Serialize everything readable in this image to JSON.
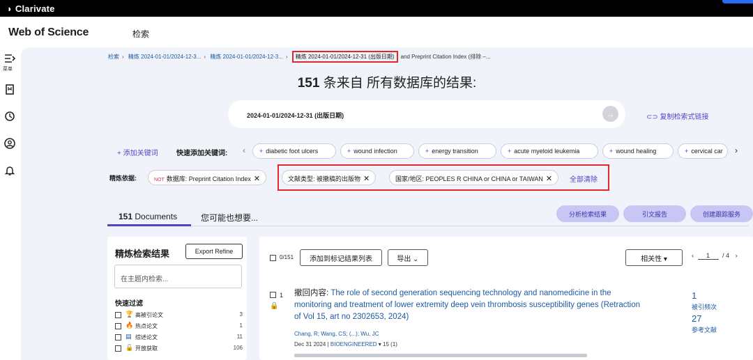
{
  "topbar": {
    "brand": "Clarivate"
  },
  "header": {
    "logo": "Web of Science",
    "nav_search": "检索"
  },
  "rail": {
    "menu_label": "菜单"
  },
  "breadcrumb": {
    "items": [
      "检索",
      "精炼 2024-01-01/2024-12-3...",
      "精炼 2024-01-01/2024-12-3..."
    ],
    "active": "精炼 2024-01-01/2024-12-31 (出版日期)",
    "tail": "and Preprint Citation Index (排除 –..."
  },
  "results": {
    "count": "151",
    "title_rest": "条来自 所有数据库的结果:"
  },
  "query": {
    "text": "2024-01-01/2024-12-31 (出版日期)",
    "go_glyph": "→"
  },
  "copy_link": "复制检索式链接",
  "keywords": {
    "add_label": "+ 添加关键词",
    "quick_label": "快速添加关键词:",
    "chips": [
      "diabetic foot ulcers",
      "wound infection",
      "energy transition",
      "acute myeloid leukemia",
      "wound healing",
      "cervical car"
    ]
  },
  "refine": {
    "label": "精炼依据:",
    "not_tag": "NOT",
    "chip1": "数据库: Preprint Citation Index",
    "chip2": "文献类型: 被撤稿的出版物",
    "chip3": "国家/地区: PEOPLES R CHINA or CHINA or TAIWAN",
    "clear_all": "全部清除"
  },
  "tabs": {
    "docs_count": "151",
    "docs_label": "Documents",
    "maybe": "您可能也想要..."
  },
  "actions": {
    "analyze": "分析检索结果",
    "citation_report": "引文报告",
    "create_alert": "创建跟踪服务"
  },
  "left_panel": {
    "title": "精炼检索结果",
    "export": "Export Refine",
    "search_placeholder": "在主题内检索...",
    "quick_filter": "快速过滤",
    "filters": [
      {
        "icon": "trophy-icon",
        "glyph": "🏆",
        "label": "高被引论文",
        "count": "3"
      },
      {
        "icon": "flame-icon",
        "glyph": "🔥",
        "label": "热点论文",
        "count": "1"
      },
      {
        "icon": "review-doc-icon",
        "glyph": "▤",
        "label": "综述论文",
        "count": "11"
      },
      {
        "icon": "open-access-icon",
        "glyph": "🔓",
        "label": "开放获取",
        "count": "106"
      }
    ]
  },
  "right_panel": {
    "select_count": "0/151",
    "add_to_list": "添加到标记结果列表",
    "export": "导出 ⌄",
    "sort": "相关性 ▾",
    "page_current": "1",
    "page_total": "/ 4"
  },
  "record": {
    "number": "1",
    "prefix": "撤回内容: ",
    "title": "The role of second generation sequencing technology and nanomedicine in the monitoring and treatment of lower extremity deep vein thrombosis susceptibility genes (Retraction of Vol 15, art no 2302653, 2024)",
    "authors": "Chang, R; Wang, CS; (...); Wu, JC",
    "date": "Dec 31 2024 | ",
    "journal": "BIOENGINEERED",
    "issue": " ▾  15 (1)",
    "cites": "1",
    "cites_label": "被引频次",
    "refs": "27",
    "refs_label": "参考文献"
  }
}
